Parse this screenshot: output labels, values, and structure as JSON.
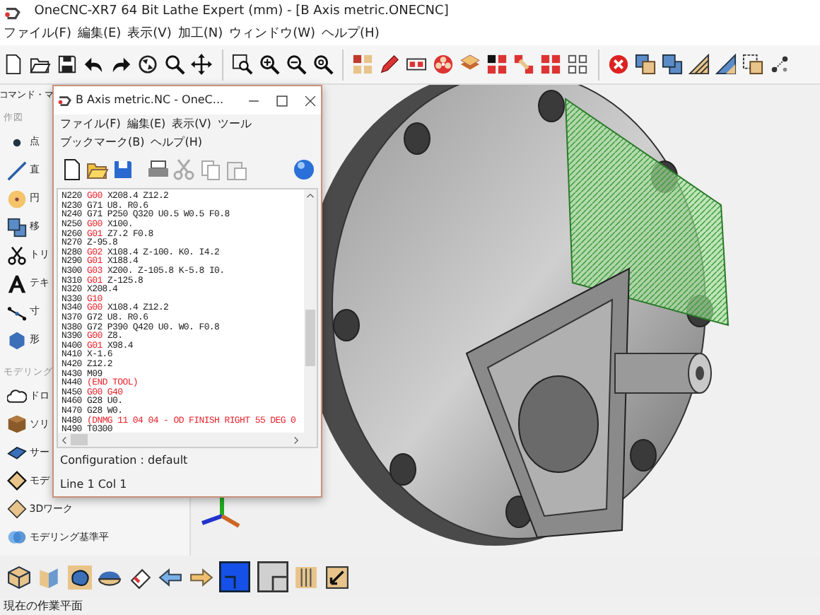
{
  "window": {
    "title": "OneCNC-XR7  64 Bit Lathe Expert (mm) - [B Axis metric.ONECNC]"
  },
  "menu": [
    "ファイル(F)",
    "編集(E)",
    "表示(V)",
    "加工(N)",
    "ウィンドウ(W)",
    "ヘルプ(H)"
  ],
  "sidebar": {
    "title": "コマンド・マ",
    "sections": [
      {
        "heading": "作図",
        "items": [
          "点",
          "直",
          "円",
          "移",
          "トリ",
          "テキ",
          "寸",
          "形"
        ]
      },
      {
        "heading": "モデリング",
        "items": [
          "ドロ",
          "ソリ",
          "サー",
          "モデ",
          "3Dワーク",
          "モデリング基準平"
        ]
      }
    ]
  },
  "editor": {
    "title": "B Axis metric.NC - OneC...",
    "menu_rows": [
      [
        "ファイル(F)",
        "編集(E)",
        "表示(V)",
        "ツール"
      ],
      [
        "ブックマーク(B)",
        "ヘルプ(H)"
      ]
    ],
    "lines": [
      [
        {
          "text": "N220",
          "kind": "plain"
        },
        {
          "text": "G00",
          "kind": "gcode"
        },
        {
          "text": "X208.4 Z12.2",
          "kind": "plain"
        }
      ],
      [
        {
          "text": "N230 G71 U8. R0.6",
          "kind": "plain"
        }
      ],
      [
        {
          "text": "N240 G71 P250 Q320 U0.5 W0.5 F0.8",
          "kind": "plain"
        }
      ],
      [
        {
          "text": "N250",
          "kind": "plain"
        },
        {
          "text": "G00",
          "kind": "gcode"
        },
        {
          "text": "X100.",
          "kind": "plain"
        }
      ],
      [
        {
          "text": "N260",
          "kind": "plain"
        },
        {
          "text": "G01",
          "kind": "gcode"
        },
        {
          "text": "Z7.2 F0.8",
          "kind": "plain"
        }
      ],
      [
        {
          "text": "N270 Z-95.8",
          "kind": "plain"
        }
      ],
      [
        {
          "text": "N280",
          "kind": "plain"
        },
        {
          "text": "G02",
          "kind": "gcode"
        },
        {
          "text": "X108.4 Z-100. K0. I4.2",
          "kind": "plain"
        }
      ],
      [
        {
          "text": "N290",
          "kind": "plain"
        },
        {
          "text": "G01",
          "kind": "gcode"
        },
        {
          "text": "X188.4",
          "kind": "plain"
        }
      ],
      [
        {
          "text": "N300",
          "kind": "plain"
        },
        {
          "text": "G03",
          "kind": "gcode"
        },
        {
          "text": "X200. Z-105.8 K-5.8 I0.",
          "kind": "plain"
        }
      ],
      [
        {
          "text": "N310",
          "kind": "plain"
        },
        {
          "text": "G01",
          "kind": "gcode"
        },
        {
          "text": "Z-125.8",
          "kind": "plain"
        }
      ],
      [
        {
          "text": "N320 X208.4",
          "kind": "plain"
        }
      ],
      [
        {
          "text": "N330",
          "kind": "plain"
        },
        {
          "text": "G10",
          "kind": "gcode"
        }
      ],
      [
        {
          "text": "N340",
          "kind": "plain"
        },
        {
          "text": "G00",
          "kind": "gcode"
        },
        {
          "text": "X108.4 Z12.2",
          "kind": "plain"
        }
      ],
      [
        {
          "text": "N370 G72 U8. R0.6",
          "kind": "plain"
        }
      ],
      [
        {
          "text": "N380 G72 P390 Q420 U0. W0. F0.8",
          "kind": "plain"
        }
      ],
      [
        {
          "text": "N390",
          "kind": "plain"
        },
        {
          "text": "G00",
          "kind": "gcode"
        },
        {
          "text": "Z8.",
          "kind": "plain"
        }
      ],
      [
        {
          "text": "N400",
          "kind": "plain"
        },
        {
          "text": "G01",
          "kind": "gcode"
        },
        {
          "text": "X98.4",
          "kind": "plain"
        }
      ],
      [
        {
          "text": "N410 X-1.6",
          "kind": "plain"
        }
      ],
      [
        {
          "text": "N420 Z12.2",
          "kind": "plain"
        }
      ],
      [
        {
          "text": "N430 M09",
          "kind": "plain"
        }
      ],
      [
        {
          "text": "N440",
          "kind": "plain"
        },
        {
          "text": "(END TOOL)",
          "kind": "gcode"
        }
      ],
      [
        {
          "text": "N450",
          "kind": "plain"
        },
        {
          "text": "G00 G40",
          "kind": "gcode"
        }
      ],
      [
        {
          "text": "N460 G28 U0.",
          "kind": "plain"
        }
      ],
      [
        {
          "text": "N470 G28 W0.",
          "kind": "plain"
        }
      ],
      [
        {
          "text": "N480",
          "kind": "plain"
        },
        {
          "text": "(DNMG 11 04 04 - OD FINISH RIGHT 55 DEG 0",
          "kind": "gcode"
        }
      ],
      [
        {
          "text": "N490 T0300",
          "kind": "plain"
        }
      ]
    ],
    "configuration": "Configuration : default",
    "position": "Line 1 Col 1"
  },
  "status_bar": "現在の作業平面"
}
